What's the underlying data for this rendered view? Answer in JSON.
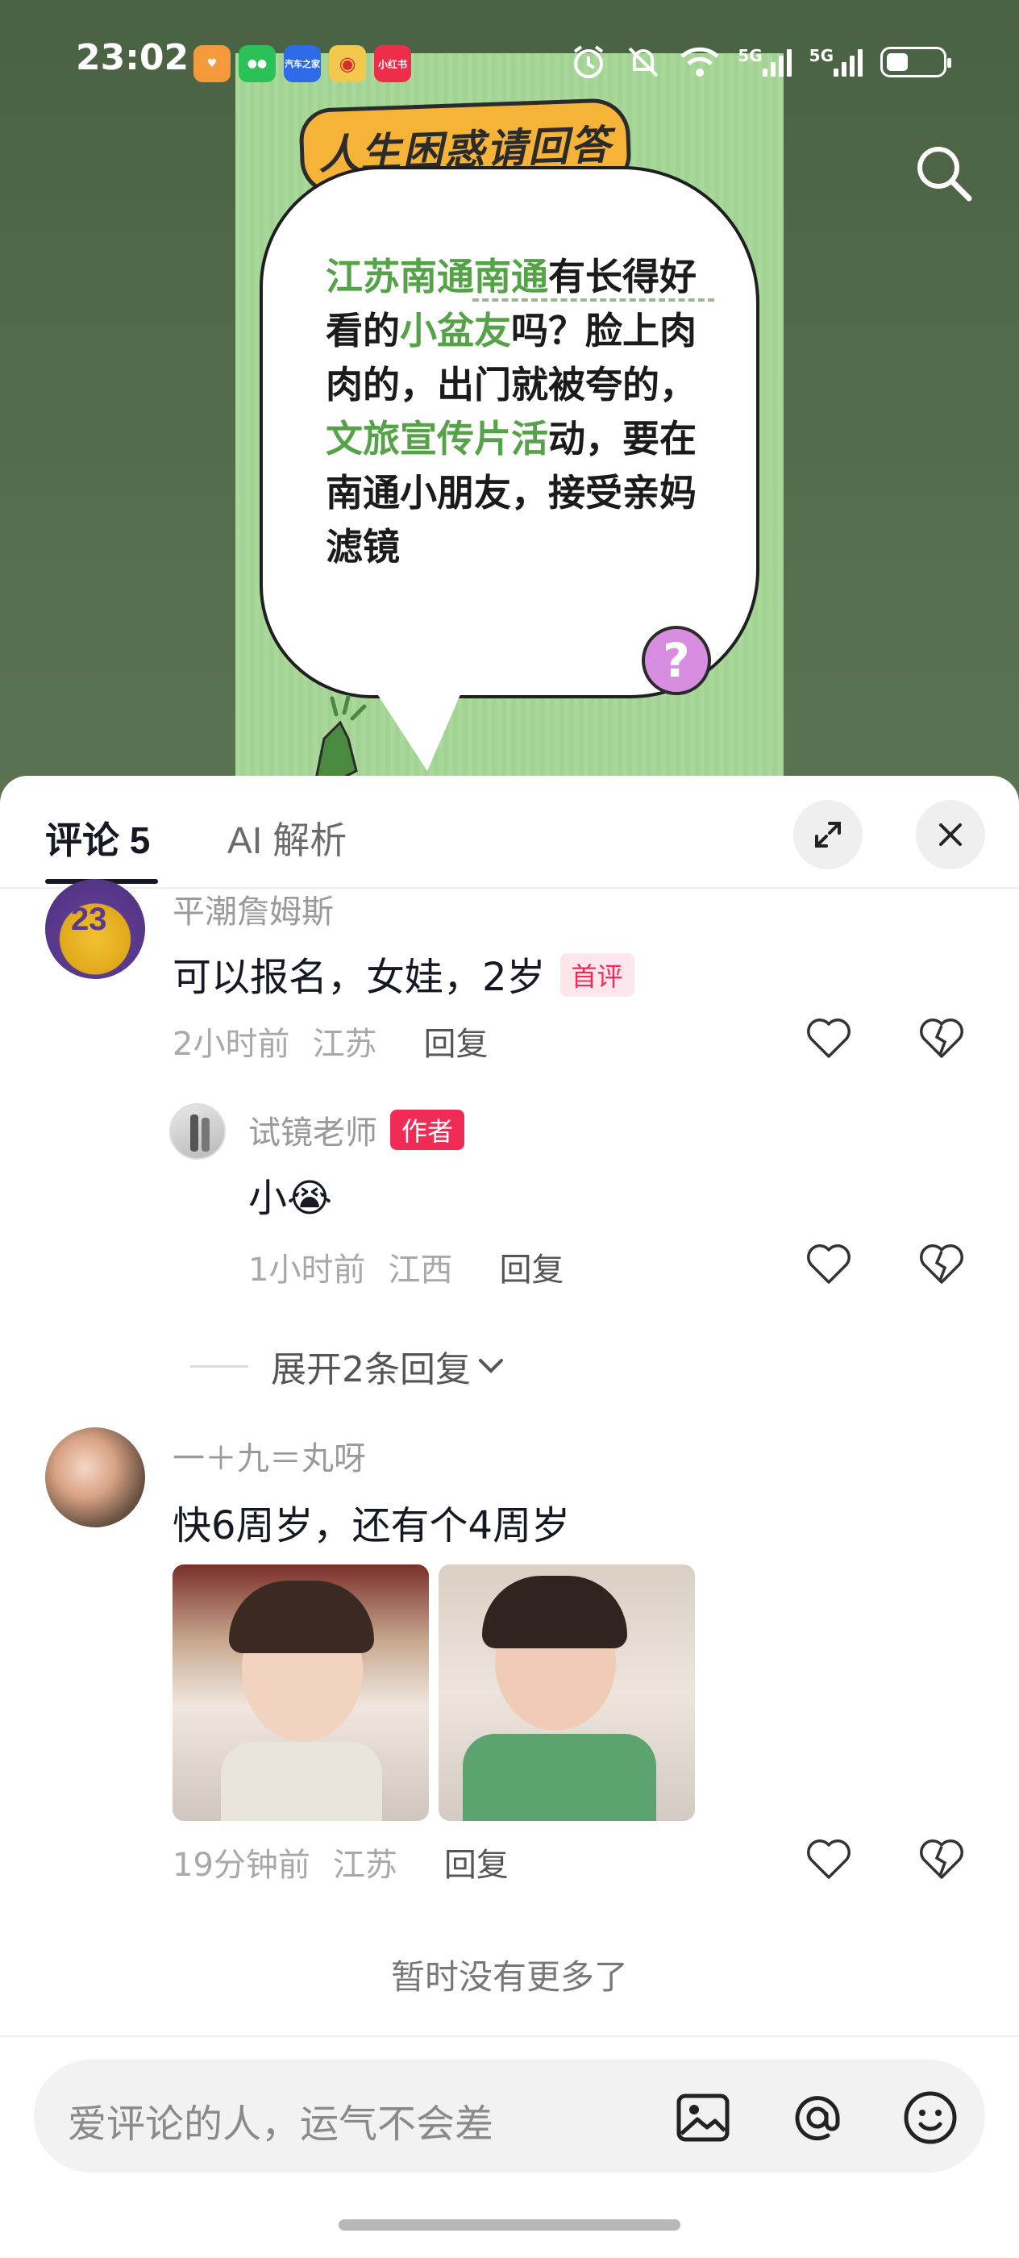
{
  "status_bar": {
    "time": "23:02",
    "apps": [
      {
        "icon": "heart-app-icon",
        "color": "#f59a3b",
        "label": ""
      },
      {
        "icon": "wechat-icon",
        "color": "#2bc156",
        "label": ""
      },
      {
        "icon": "autohome-icon",
        "color": "#2f6be8",
        "label": "汽车之家"
      },
      {
        "icon": "weibo-icon",
        "color": "#f2c94c",
        "label": ""
      },
      {
        "icon": "xiaohongshu-icon",
        "color": "#ee2d4a",
        "label": "小红书"
      }
    ],
    "net1": "5G",
    "net2": "5G",
    "battery_level": 0.4
  },
  "poster": {
    "banner": "人生困惑请回答",
    "line_parts": [
      {
        "text": "江苏南通南通",
        "hl": true
      },
      {
        "text": "有长得好看的",
        "hl": false
      },
      {
        "text": "小盆友",
        "hl": true
      },
      {
        "text": "吗？脸上肉肉的，出门就被夸的，",
        "hl": false
      },
      {
        "text": "文旅宣传片活",
        "hl": true
      },
      {
        "text": "动，要在南通小朋友，接受亲妈滤镜",
        "hl": false
      }
    ],
    "qmark": "?"
  },
  "sheet": {
    "tab_comments": "评论 5",
    "tab_ai": "AI 解析"
  },
  "comments": [
    {
      "user": "平潮詹姆斯",
      "text": "可以报名，女娃，2岁",
      "badge": "首评",
      "time": "2小时前",
      "location": "江苏",
      "reply": "回复"
    },
    {
      "user": "试镜老师",
      "badge": "作者",
      "text": "小",
      "emoji": "😭",
      "time": "1小时前",
      "location": "江西",
      "reply": "回复"
    },
    {
      "user": "一＋九＝丸呀",
      "text": "快6周岁，还有个4周岁",
      "time": "19分钟前",
      "location": "江苏",
      "reply": "回复"
    }
  ],
  "expand_replies": "展开2条回复",
  "no_more": "暂时没有更多了",
  "input": {
    "placeholder": "爱评论的人，运气不会差"
  },
  "colors": {
    "accent_red": "#f02c56",
    "poster_green": "#a8d89a",
    "highlight_green": "#56a248"
  }
}
